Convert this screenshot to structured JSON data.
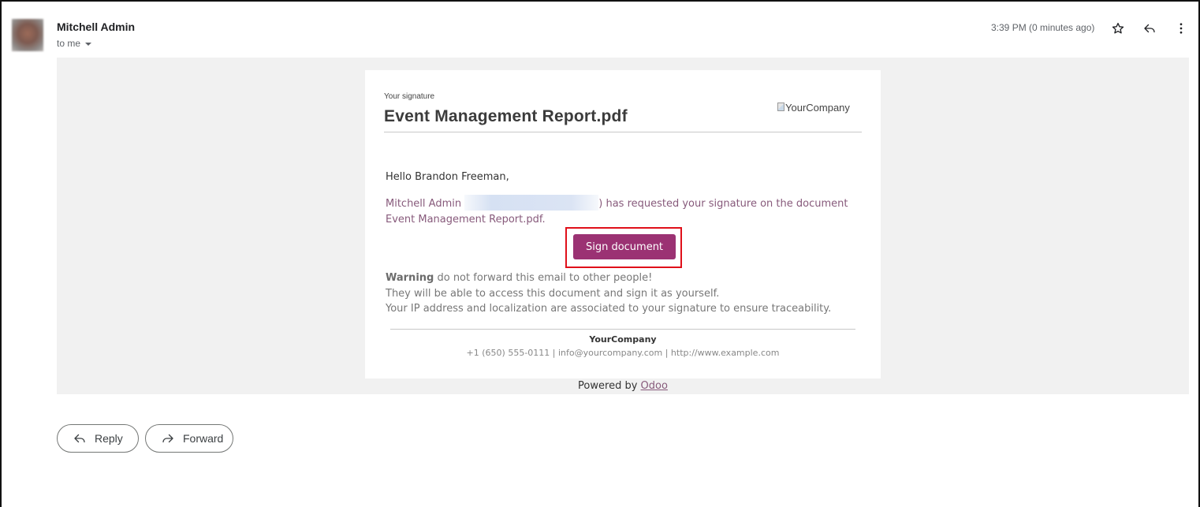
{
  "header": {
    "sender_name": "Mitchell Admin",
    "recipient": "to me",
    "time": "3:39 PM (0 minutes ago)",
    "icons": [
      "star-icon",
      "reply-icon",
      "more-vert-icon"
    ]
  },
  "email": {
    "subtitle": "Your signature",
    "title": "Event Management Report.pdf",
    "logo_alt": "YourCompany",
    "greeting": "Hello Brandon Freeman,",
    "request_sender": "Mitchell Admin",
    "request_text_1": ") has requested your signature on the document",
    "request_text_2": "Event Management Report.pdf.",
    "sign_button": "Sign document",
    "warning_label": "Warning",
    "warning_text": "do not forward this email to other people!",
    "warning_line2": "They will be able to access this document and sign it as yourself.",
    "warning_line3": "Your IP address and localization are associated to your signature to ensure traceability.",
    "company_name": "YourCompany",
    "company_info": "+1 (650) 555-0111 | info@yourcompany.com | http://www.example.com",
    "powered_by": "Powered by",
    "powered_link": "Odoo"
  },
  "actions": {
    "reply_label": "Reply",
    "forward_label": "Forward"
  },
  "colors": {
    "accent": "#875a7b",
    "button": "#9b3273",
    "highlight_border": "#e0101a"
  }
}
